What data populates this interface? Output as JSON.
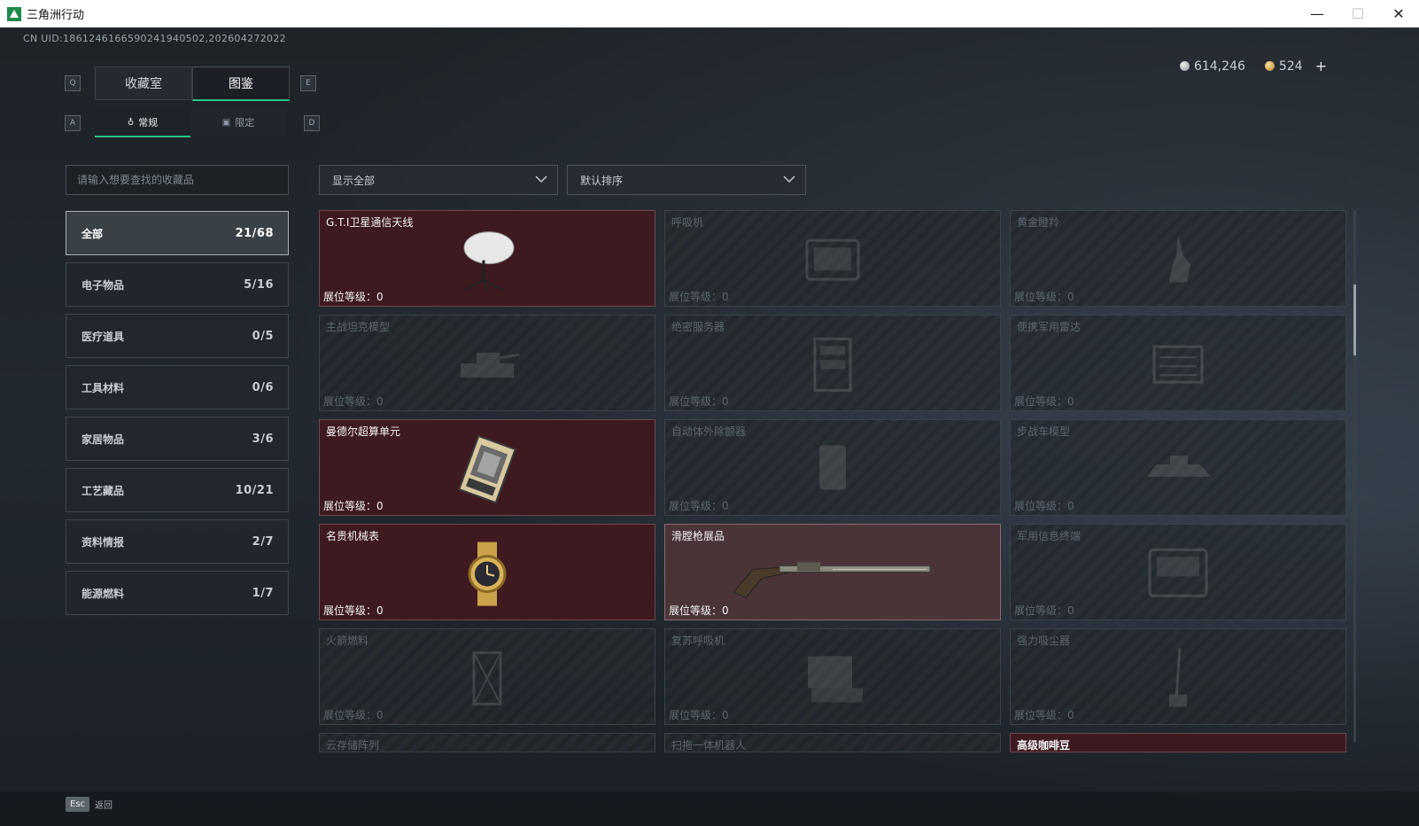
{
  "window": {
    "title": "三角洲行动",
    "minimize": "—",
    "maximize": "☐",
    "close": "✕"
  },
  "uid": "CN UID:1861246166590241940502,202604272022",
  "currency": {
    "silver": "614,246",
    "gold": "524",
    "plus": "+"
  },
  "keys": {
    "tab_left": "Q",
    "tab_right": "E",
    "sub_left": "A",
    "sub_right": "D"
  },
  "tabs": [
    {
      "label": "收藏室"
    },
    {
      "label": "图鉴"
    }
  ],
  "subtabs": [
    {
      "label": "常规"
    },
    {
      "label": "限定"
    }
  ],
  "search": {
    "placeholder": "请输入想要查找的收藏品"
  },
  "filter": {
    "value": "显示全部"
  },
  "sort": {
    "value": "默认排序"
  },
  "categories": [
    {
      "label": "全部",
      "count": "21/68"
    },
    {
      "label": "电子物品",
      "count": "5/16"
    },
    {
      "label": "医疗道具",
      "count": "0/5"
    },
    {
      "label": "工具材料",
      "count": "0/6"
    },
    {
      "label": "家居物品",
      "count": "3/6"
    },
    {
      "label": "工艺藏品",
      "count": "10/21"
    },
    {
      "label": "资料情报",
      "count": "2/7"
    },
    {
      "label": "能源燃料",
      "count": "1/7"
    }
  ],
  "level_label": "展位等级：0",
  "items": [
    {
      "name": "G.T.I卫星通信天线"
    },
    {
      "name": "呼吸机"
    },
    {
      "name": "黄金瞪羚"
    },
    {
      "name": "主战坦克模型"
    },
    {
      "name": "绝密服务器"
    },
    {
      "name": "便携军用雷达"
    },
    {
      "name": "曼德尔超算单元"
    },
    {
      "name": "自动体外除颤器"
    },
    {
      "name": "步战车模型"
    },
    {
      "name": "名贵机械表"
    },
    {
      "name": "滑膛枪展品"
    },
    {
      "name": "军用信息终端"
    },
    {
      "name": "火箭燃料"
    },
    {
      "name": "复苏呼吸机"
    },
    {
      "name": "强力吸尘器"
    },
    {
      "name": "云存储阵列"
    },
    {
      "name": "扫拖一体机器人"
    },
    {
      "name": "高级咖啡豆"
    }
  ],
  "footer": {
    "key": "Esc",
    "label": "返回"
  }
}
